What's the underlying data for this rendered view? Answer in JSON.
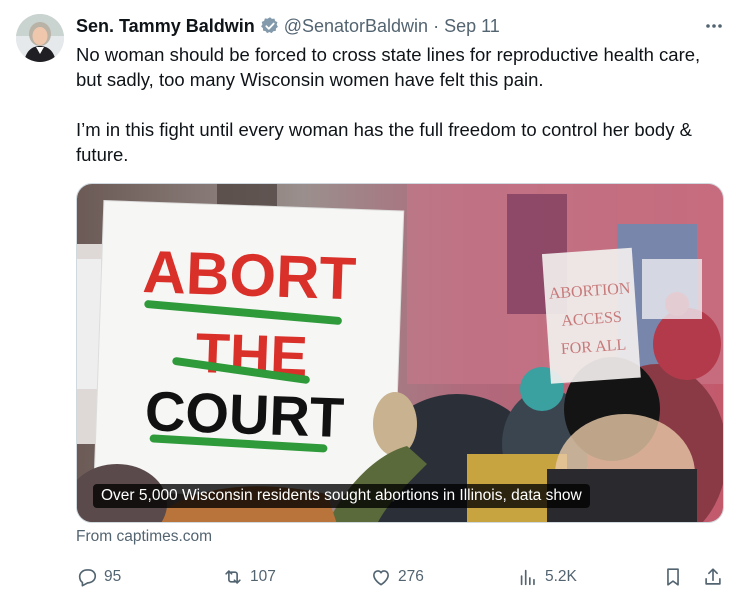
{
  "author": {
    "name": "Sen. Tammy Baldwin",
    "handle": "@SenatorBaldwin",
    "separator": "·",
    "date": "Sep 11"
  },
  "tweet": {
    "paragraph1": "No woman should be forced to cross state lines for reproductive health care, but sadly, too many Wisconsin women have felt this pain.",
    "paragraph2": "I’m in this fight until every woman has the full freedom to control her body & future."
  },
  "card": {
    "caption": "Over 5,000 Wisconsin residents sought abortions in Illinois, data show",
    "source": "From captimes.com",
    "sign_text": {
      "line1": "ABORT",
      "line2": "THE",
      "line3": "COURT",
      "background_sign_1": "ABORTION",
      "background_sign_2": "ACCESS",
      "background_sign_3": "FOR ALL"
    }
  },
  "actions": {
    "replies": "95",
    "reposts": "107",
    "likes": "276",
    "views": "5.2K"
  },
  "icons": {
    "verified": "verified-badge-icon",
    "more": "more-icon",
    "reply": "reply-icon",
    "repost": "repost-icon",
    "like": "like-icon",
    "views": "views-icon",
    "bookmark": "bookmark-icon",
    "share": "share-icon"
  },
  "colors": {
    "text": "#0f1419",
    "secondary": "#536471",
    "sign_red": "#d9302a",
    "sign_green": "#2e9a3a",
    "sign_black": "#111111"
  }
}
